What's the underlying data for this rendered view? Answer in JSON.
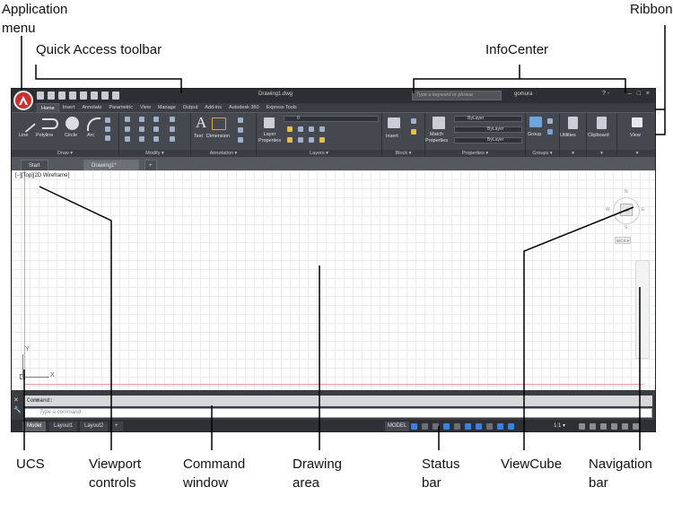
{
  "callouts": {
    "application_menu": "Application\nmenu",
    "quick_access": "Quick Access toolbar",
    "infocenter": "InfoCenter",
    "ribbon": "Ribbon",
    "ucs": "UCS",
    "viewport_controls": "Viewport\ncontrols",
    "command_window": "Command\nwindow",
    "drawing_area": "Drawing\narea",
    "status_bar": "Status\nbar",
    "viewcube": "ViewCube",
    "navigation_bar": "Navigation\nbar"
  },
  "window": {
    "title": "Drawing1.dwg",
    "search_placeholder": "Type a keyword or phrase",
    "user": "gomura",
    "help": "? -",
    "controls": "– □ ×"
  },
  "ribbon_tabs": [
    "Home",
    "Insert",
    "Annotate",
    "Parametric",
    "View",
    "Manage",
    "Output",
    "Add-ins",
    "Autodesk 360",
    "Express Tools"
  ],
  "ribbon": {
    "draw": {
      "title": "Draw ▾",
      "tools": [
        "Line",
        "Polyline",
        "Circle",
        "Arc"
      ]
    },
    "modify": {
      "title": "Modify ▾"
    },
    "annotation": {
      "title": "Annotation ▾",
      "tools": [
        "Text",
        "Dimension"
      ]
    },
    "layers": {
      "title": "Layers ▾",
      "tool_line1": "Layer",
      "tool_line2": "Properties",
      "layer_value": "0"
    },
    "block": {
      "title": "Block ▾",
      "tool": "Insert"
    },
    "properties": {
      "title": "Properties ▾",
      "tool_line1": "Match",
      "tool_line2": "Properties",
      "bylayer": "ByLayer"
    },
    "groups": {
      "title": "Groups ▾",
      "tool": "Group"
    },
    "utilities": {
      "tool": "Utilities"
    },
    "clipboard": {
      "tool": "Clipboard"
    },
    "view": {
      "tool": "View"
    }
  },
  "file_tabs": [
    "Start",
    "Drawing1*",
    "+"
  ],
  "viewport": {
    "label": "[−][Top][2D Wireframe]",
    "viewcube_letters": {
      "n": "N",
      "s": "S",
      "e": "E",
      "w": "W"
    },
    "viewcube_face": "TOP",
    "wcs": "WCS ▾"
  },
  "ucs": {
    "x": "X",
    "y": "Y"
  },
  "command": {
    "history": "Command:",
    "placeholder": "Type a command",
    "side_icons": "✕\n🔧"
  },
  "layout_tabs": [
    "Model",
    "Layout1",
    "Layout2",
    "+"
  ],
  "status": {
    "model": "MODEL",
    "scale": "1:1 ▾"
  }
}
